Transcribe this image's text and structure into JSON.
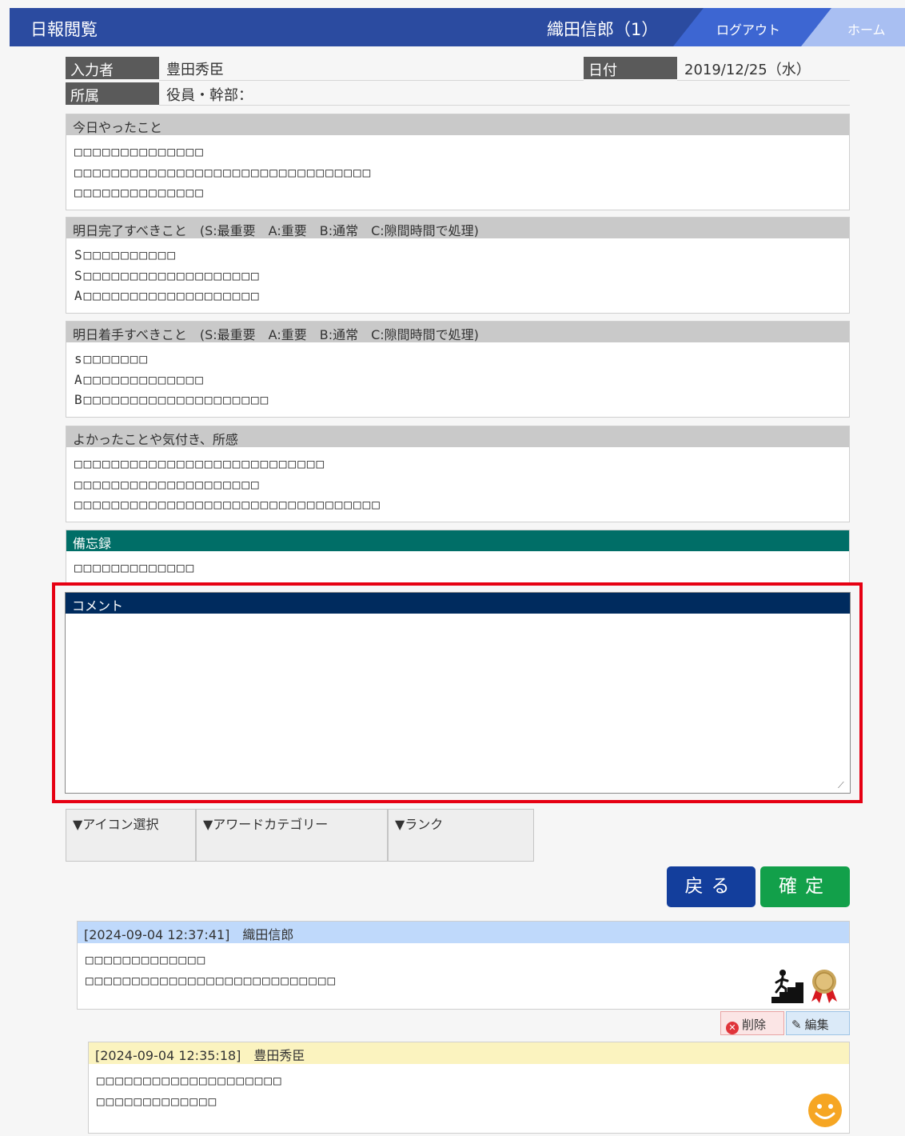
{
  "header": {
    "title": "日報閲覧",
    "user": "織田信郎（1）",
    "logout_label": "ログアウト",
    "home_label": "ホーム"
  },
  "info": {
    "inputter_label": "入力者",
    "inputter_value": "豊田秀臣",
    "date_label": "日付",
    "date_value": "2019/12/25（水）",
    "affiliation_label": "所属",
    "affiliation_value": "役員・幹部："
  },
  "sections": {
    "today": {
      "title": "今日やったこと",
      "lines": [
        "□□□□□□□□□□□□□□",
        "□□□□□□□□□□□□□□□□□□□□□□□□□□□□□□□□",
        "□□□□□□□□□□□□□□"
      ]
    },
    "tomorrow_complete": {
      "title": "明日完了すべきこと　(S:最重要　A:重要　B:通常　C:隙間時間で処理)",
      "lines": [
        "S□□□□□□□□□□",
        "S□□□□□□□□□□□□□□□□□□□",
        "A□□□□□□□□□□□□□□□□□□□"
      ]
    },
    "tomorrow_start": {
      "title": "明日着手すべきこと　(S:最重要　A:重要　B:通常　C:隙間時間で処理)",
      "lines": [
        "s□□□□□□□",
        "A□□□□□□□□□□□□□",
        "B□□□□□□□□□□□□□□□□□□□□"
      ]
    },
    "good_things": {
      "title": "よかったことや気付き、所感",
      "lines": [
        "□□□□□□□□□□□□□□□□□□□□□□□□□□□",
        "□□□□□□□□□□□□□□□□□□□□",
        "□□□□□□□□□□□□□□□□□□□□□□□□□□□□□□□□□"
      ]
    },
    "memo": {
      "title": "備忘録",
      "lines": [
        "□□□□□□□□□□□□□"
      ]
    }
  },
  "comment": {
    "title": "コメント",
    "value": ""
  },
  "selectors": {
    "icon": "▼アイコン選択",
    "award": "▼アワードカテゴリー",
    "rank": "▼ランク"
  },
  "buttons": {
    "back": "戻る",
    "confirm": "確定"
  },
  "comments": [
    {
      "header": "[2024-09-04 12:37:41]　織田信郎",
      "lines": [
        "□□□□□□□□□□□□□",
        "□□□□□□□□□□□□□□□□□□□□□□□□□□□"
      ],
      "icons": [
        "stairs-climber-icon",
        "medal-ribbon-icon"
      ],
      "header_color": "#bfd9fb",
      "actions": {
        "delete": "削除",
        "edit": "編集"
      }
    },
    {
      "header": "[2024-09-04 12:35:18]　豊田秀臣",
      "lines": [
        "□□□□□□□□□□□□□□□□□□□□",
        "□□□□□□□□□□□□□"
      ],
      "icons": [
        "smiley-face-icon"
      ],
      "header_color": "#fbf3bf"
    }
  ],
  "colors": {
    "header_bg": "#2b4ba0",
    "memo_header": "#006e67",
    "comment_header": "#002b5e",
    "highlight": "#e60012",
    "back_button": "#133e9c",
    "confirm_button": "#12a04a"
  }
}
